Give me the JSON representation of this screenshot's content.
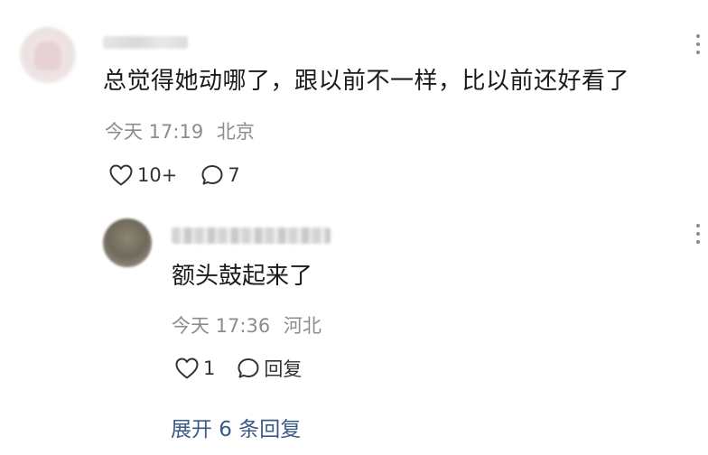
{
  "comment": {
    "text": "总觉得她动哪了，跟以前不一样，比以前还好看了",
    "time": "今天 17:19",
    "location": "北京",
    "likes": "10+",
    "replies": "7"
  },
  "reply": {
    "text": "额头鼓起来了",
    "time": "今天 17:36",
    "location": "河北",
    "likes": "1",
    "reply_label": "回复"
  },
  "expand_label": "展开 6 条回复",
  "icons": {
    "like": "heart-outline-icon",
    "comment": "speech-bubble-icon",
    "more": "vertical-dots-icon"
  },
  "colors": {
    "meta_text": "#8c8c8c",
    "link": "#3b5a86"
  }
}
